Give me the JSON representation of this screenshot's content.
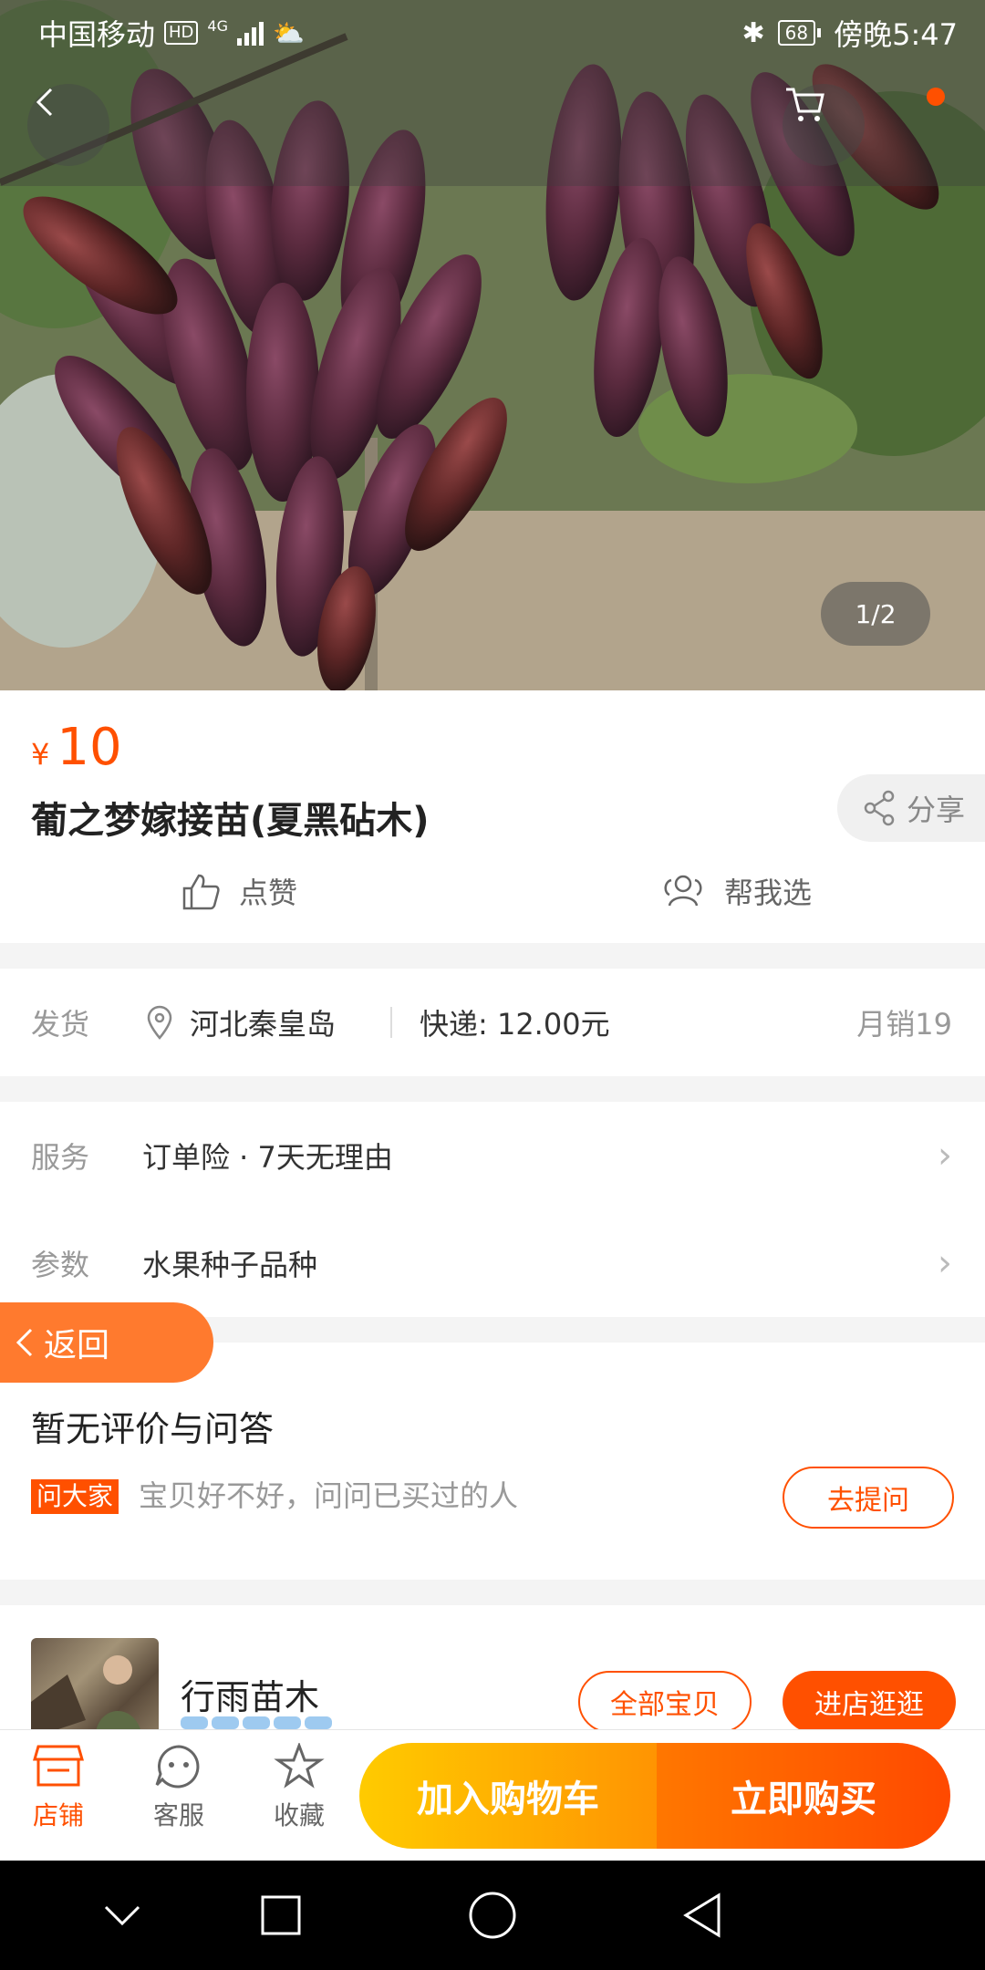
{
  "status_bar": {
    "carrier": "中国移动",
    "hd": "HD",
    "network": "4G",
    "battery": "68",
    "time": "傍晚5:47"
  },
  "gallery": {
    "counter": "1/2"
  },
  "product": {
    "currency": "¥",
    "price": "10",
    "title": "葡之梦嫁接苗(夏黑砧木)",
    "share_label": "分享",
    "like_label": "点赞",
    "help_choose_label": "帮我选"
  },
  "shipping": {
    "label": "发货",
    "location": "河北秦皇岛",
    "fee": "快递: 12.00元",
    "monthly_sales": "月销19"
  },
  "service": {
    "service_label": "服务",
    "service_value": "订单险 · 7天无理由",
    "params_label": "参数",
    "params_value": "水果种子品种"
  },
  "float_back": {
    "label": "返回"
  },
  "reviews": {
    "title": "暂无评价与问答",
    "ask_tag": "问大家",
    "ask_hint": "宝贝好不好，问问已买过的人",
    "ask_button": "去提问"
  },
  "shop": {
    "name": "行雨苗木",
    "all_items_button": "全部宝贝",
    "enter_shop_button": "进店逛逛"
  },
  "bottom_bar": {
    "shop_label": "店铺",
    "service_label": "客服",
    "favorite_label": "收藏",
    "add_to_cart": "加入购物车",
    "buy_now": "立即购买"
  },
  "colors": {
    "accent": "#ff5000",
    "cart_gradient": [
      "#ffcb00",
      "#ff9402"
    ],
    "buy_gradient": [
      "#ff7700",
      "#ff4900"
    ]
  },
  "icons": [
    "back-arrow-icon",
    "cart-icon",
    "share-icon",
    "thumbs-up-icon",
    "people-icon",
    "location-pin-icon",
    "chevron-right-icon",
    "store-icon",
    "customer-service-icon",
    "star-icon",
    "nav-back-icon",
    "nav-home-icon",
    "nav-recents-icon",
    "nav-collapse-icon"
  ]
}
